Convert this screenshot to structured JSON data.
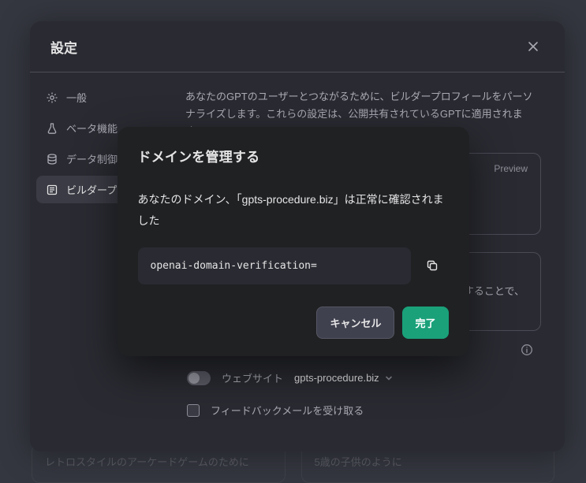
{
  "backdrop": {
    "left_card": "レトロスタイルのアーケードゲームのために",
    "right_card": "5歳の子供のように"
  },
  "settings": {
    "title": "設定",
    "sidebar": {
      "items": [
        {
          "label": "一般"
        },
        {
          "label": "ベータ機能"
        },
        {
          "label": "データ制御"
        },
        {
          "label": "ビルダープロフィール"
        }
      ]
    },
    "content": {
      "intro": "あなたのGPTのユーザーとつながるために、ビルダープロフィールをパーソナライズします。これらの設定は、公開共有されているGPTに適用されます。",
      "preview_tag": "Preview",
      "middle_card_text_suffix": "することで、",
      "website": {
        "label": "ウェブサイト",
        "domain": "gpts-procedure.biz"
      },
      "feedback_label": "フィードバックメールを受け取る"
    }
  },
  "modal": {
    "title": "ドメインを管理する",
    "message": "あなたのドメイン、「gpts-procedure.biz」は正常に確認されました",
    "code": "openai-domain-verification=",
    "cancel": "キャンセル",
    "done": "完了"
  }
}
